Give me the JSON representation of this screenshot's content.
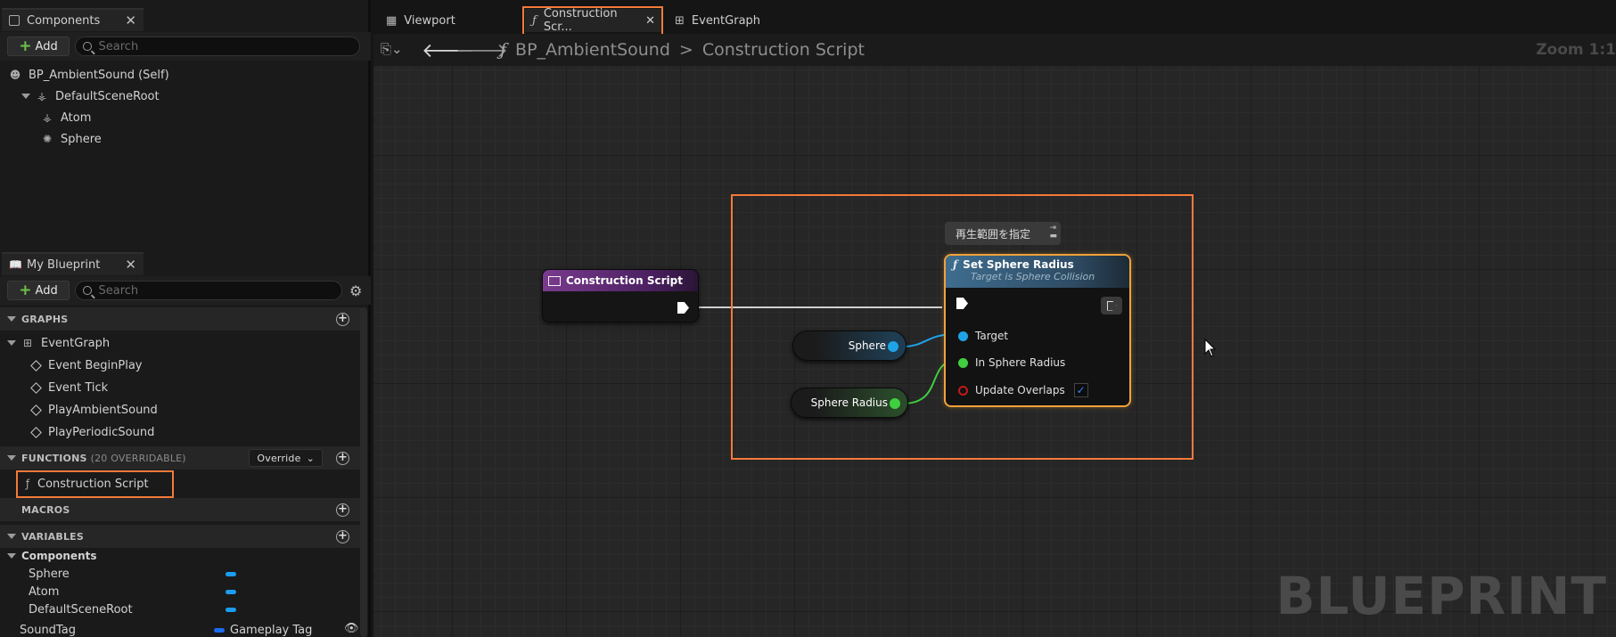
{
  "components_panel": {
    "tab_title": "Components",
    "add_label": "Add",
    "search_placeholder": "Search",
    "tree": [
      {
        "label": "BP_AmbientSound (Self)"
      },
      {
        "label": "DefaultSceneRoot"
      },
      {
        "label": "Atom"
      },
      {
        "label": "Sphere"
      }
    ]
  },
  "my_blueprint": {
    "tab_title": "My Blueprint",
    "add_label": "Add",
    "search_placeholder": "Search",
    "graphs_header": "GRAPHS",
    "graph_items": [
      {
        "label": "EventGraph"
      },
      {
        "label": "Event BeginPlay"
      },
      {
        "label": "Event Tick"
      },
      {
        "label": "PlayAmbientSound"
      },
      {
        "label": "PlayPeriodicSound"
      }
    ],
    "functions_header": "FUNCTIONS",
    "functions_sub": "(20 OVERRIDABLE)",
    "override_label": "Override",
    "function_items": [
      {
        "label": "Construction Script"
      }
    ],
    "macros_header": "MACROS",
    "variables_header": "VARIABLES",
    "components_group": "Components",
    "variable_items": [
      {
        "label": "Sphere",
        "color": "#1c9cf0"
      },
      {
        "label": "Atom",
        "color": "#1c9cf0"
      },
      {
        "label": "DefaultSceneRoot",
        "color": "#1c9cf0"
      },
      {
        "label": "SoundTag",
        "type": "Gameplay Tag",
        "color": "#1c6cf0"
      }
    ]
  },
  "doc_tabs": [
    {
      "label": "Viewport",
      "icon": "grid-icon"
    },
    {
      "label": "Construction Scr...",
      "icon": "function-icon",
      "active": true
    },
    {
      "label": "EventGraph",
      "icon": "graph-icon"
    }
  ],
  "graph_toolbar": {
    "breadcrumb_root": "BP_AmbientSound",
    "breadcrumb_sep": ">",
    "breadcrumb_leaf": "Construction Script",
    "zoom_label": "Zoom 1:1"
  },
  "graph": {
    "construction_node_title": "Construction Script",
    "comment_text": "再生範囲を指定",
    "set_node_title": "Set Sphere Radius",
    "set_node_subtitle": "Target is Sphere Collision",
    "pins": {
      "target": "Target",
      "radius": "In Sphere Radius",
      "overlaps": "Update Overlaps",
      "overlaps_checked": true
    },
    "var_sphere": "Sphere",
    "var_radius": "Sphere Radius",
    "watermark": "BLUEPRINT",
    "colors": {
      "object_pin": "#1fa3e8",
      "float_pin": "#3fcf3f",
      "bool_pin": "#c21a1a",
      "highlight": "#f47a3a"
    }
  }
}
